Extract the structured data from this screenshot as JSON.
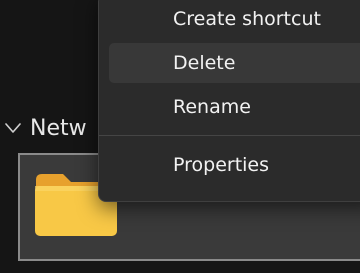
{
  "explorer": {
    "group_header": "Netw",
    "group_icon": "chevron-down-icon",
    "selected_item_icon": "folder-icon",
    "colors": {
      "background": "#151515",
      "tile_background": "#3a3a3a",
      "tile_border": "#8a8a8a",
      "folder_yellow": "#f8c846"
    }
  },
  "context_menu": {
    "items": [
      {
        "label": "Create shortcut",
        "hovered": false
      },
      {
        "label": "Delete",
        "hovered": true
      },
      {
        "label": "Rename",
        "hovered": false
      },
      {
        "label": "Properties",
        "hovered": false
      }
    ],
    "colors": {
      "background": "#2b2b2b",
      "hover": "#383838",
      "text": "#f2f2f2",
      "divider": "#454545"
    }
  }
}
